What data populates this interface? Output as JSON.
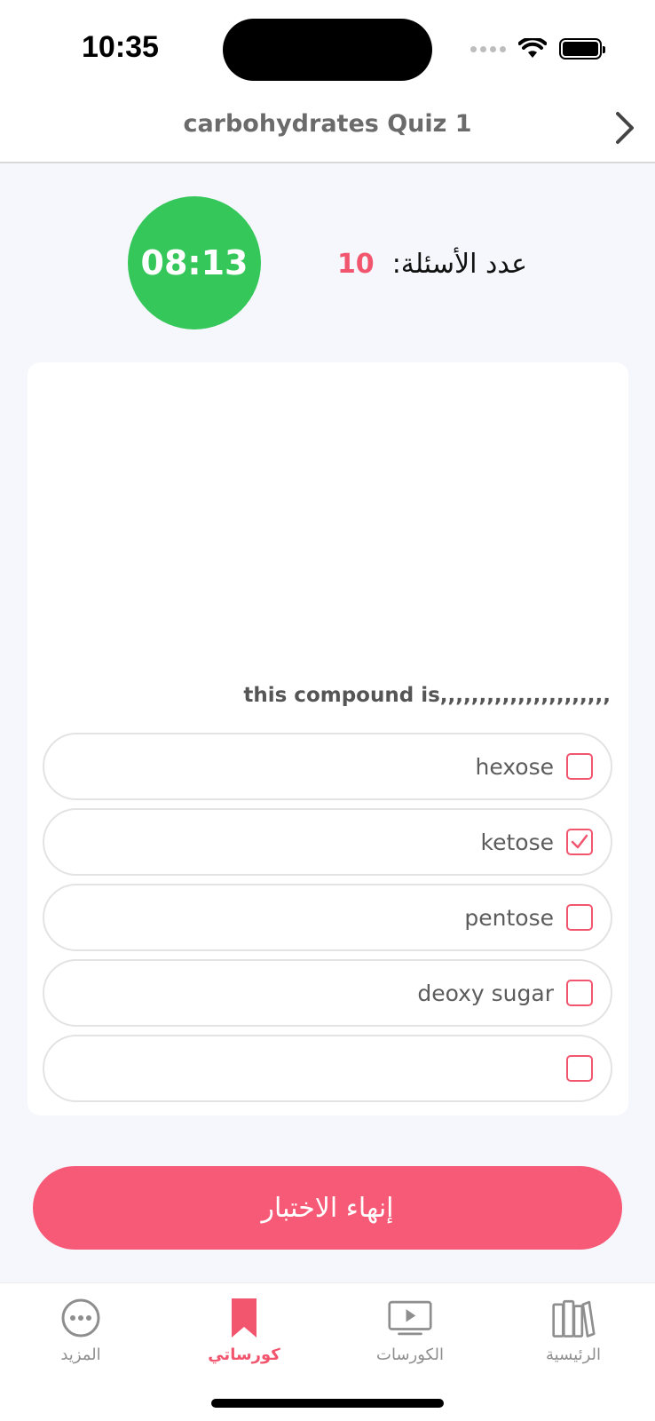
{
  "status_bar": {
    "time": "10:35"
  },
  "header": {
    "title": "carbohydrates Quiz 1"
  },
  "quiz": {
    "timer": "08:13",
    "question_count_label": "عدد الأسئلة:",
    "question_count": "10",
    "question_text": "this compound is,,,,,,,,,,,,,,,,,,,,,,",
    "options": [
      {
        "label": "hexose",
        "checked": false
      },
      {
        "label": "ketose",
        "checked": true
      },
      {
        "label": "pentose",
        "checked": false
      },
      {
        "label": "deoxy sugar",
        "checked": false
      },
      {
        "label": "",
        "checked": false
      }
    ],
    "finish_label": "إنهاء الاختبار"
  },
  "tab_bar": {
    "tabs": [
      {
        "label": "المزيد",
        "icon": "more-icon",
        "active": false
      },
      {
        "label": "كورساتي",
        "icon": "bookmark-icon",
        "active": true
      },
      {
        "label": "الكورسات",
        "icon": "play-video-icon",
        "active": false
      },
      {
        "label": "الرئيسية",
        "icon": "books-icon",
        "active": false
      }
    ]
  },
  "colors": {
    "accent": "#f2566f",
    "button": "#f75a76",
    "timer": "#35c759"
  }
}
